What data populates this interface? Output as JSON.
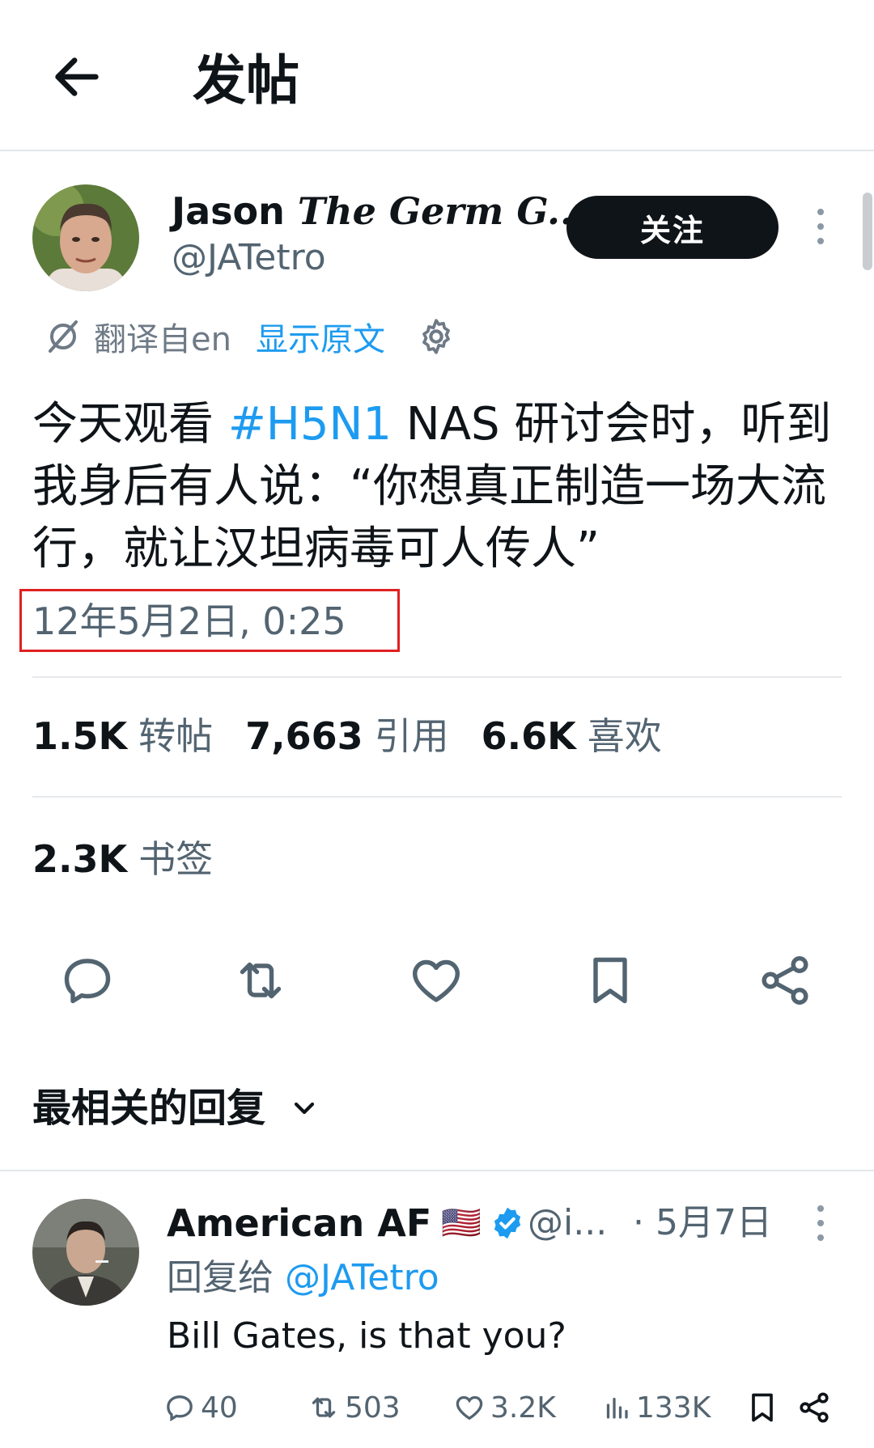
{
  "header": {
    "back_icon": "arrow-left-icon",
    "title": "发帖"
  },
  "tweet": {
    "author_name_prefix": "Jason ",
    "author_name_italic": "The Germ G...",
    "handle": "@JATetro",
    "follow_label": "关注",
    "translate": {
      "label": "翻译自en",
      "show_original": "显示原文",
      "icon": "translate-icon",
      "settings_icon": "gear-icon"
    },
    "text_before_tag": "今天观看 ",
    "hashtag": "#H5N1",
    "text_after_tag": " NAS 研讨会时，听到我身后有人说：“你想真正制造一场大流行，就让汉坦病毒可人传人”",
    "timestamp": "12年5月2日, 0:25",
    "stats": {
      "reposts_value": "1.5K",
      "reposts_label": "转帖",
      "quotes_value": "7,663",
      "quotes_label": "引用",
      "likes_value": "6.6K",
      "likes_label": "喜欢",
      "bookmarks_value": "2.3K",
      "bookmarks_label": "书签"
    },
    "actions": [
      "reply-icon",
      "repost-icon",
      "like-icon",
      "bookmark-icon",
      "share-icon"
    ]
  },
  "replies_section": {
    "title": "最相关的回复",
    "icon": "chevron-down-icon"
  },
  "reply": {
    "author_name": "American AF",
    "flag": "🇺🇸",
    "verified_icon": "verified-badge-icon",
    "handle": "@i...",
    "date": "· 5月7日",
    "reply_to_prefix": "回复给 ",
    "reply_to_handle": "@JATetro",
    "text": "Bill Gates, is that you?",
    "counts": {
      "replies": "40",
      "reposts": "503",
      "likes": "3.2K",
      "views": "133K"
    }
  },
  "colors": {
    "accent": "#1d9bf0",
    "text": "#0f1419",
    "muted": "#536471",
    "highlight": "#e02020"
  }
}
